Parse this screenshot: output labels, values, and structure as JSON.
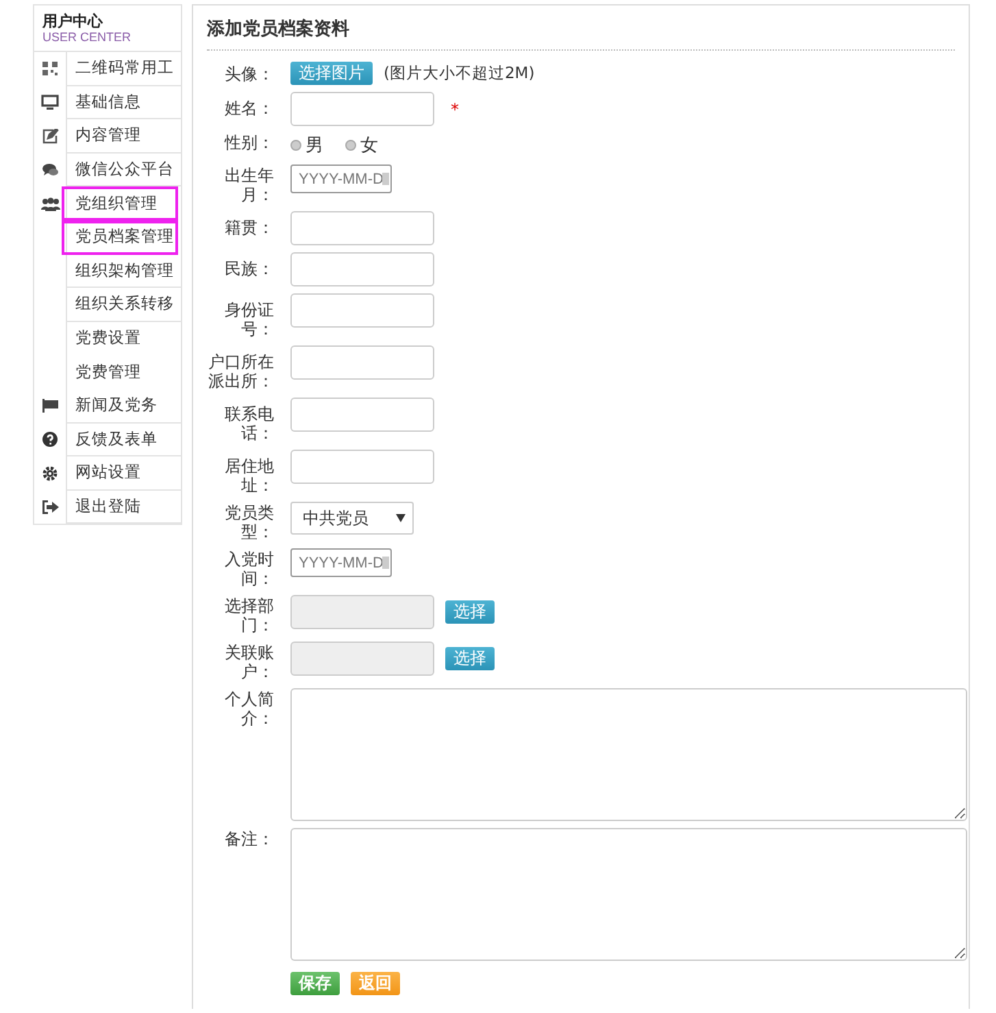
{
  "sidebar": {
    "title": "用户中心",
    "subtitle": "USER CENTER",
    "items": [
      {
        "label": "二维码常用工",
        "highlighted": false
      },
      {
        "label": "基础信息",
        "highlighted": false
      },
      {
        "label": "内容管理",
        "highlighted": false
      },
      {
        "label": "微信公众平台",
        "highlighted": false
      },
      {
        "label": "党组织管理",
        "highlighted": true,
        "children": [
          {
            "label": "党员档案管理",
            "highlighted": true
          },
          {
            "label": "组织架构管理",
            "highlighted": false
          },
          {
            "label": "组织关系转移",
            "highlighted": false
          },
          {
            "label": "党费设置",
            "highlighted": false
          },
          {
            "label": "党费管理",
            "highlighted": false
          }
        ]
      },
      {
        "label": "新闻及党务",
        "highlighted": false
      },
      {
        "label": "反馈及表单",
        "highlighted": false
      },
      {
        "label": "网站设置",
        "highlighted": false
      },
      {
        "label": "退出登陆",
        "highlighted": false
      }
    ]
  },
  "form": {
    "title": "添加党员档案资料",
    "fields": [
      {
        "kind": "file",
        "label": "头像：",
        "button": "选择图片",
        "note": "(图片大小不超过2M)"
      },
      {
        "kind": "text",
        "label": "姓名：",
        "required_mark": "*"
      },
      {
        "kind": "radio",
        "label": "性别：",
        "options": [
          {
            "label": "男",
            "selected": false
          },
          {
            "label": "女",
            "selected": false
          }
        ]
      },
      {
        "kind": "date",
        "label": "出生年月：",
        "placeholder": "YYYY-MM-D"
      },
      {
        "kind": "text",
        "label": "籍贯："
      },
      {
        "kind": "text",
        "label": "民族："
      },
      {
        "kind": "text",
        "label": "身份证号："
      },
      {
        "kind": "text",
        "label": "户口所在派出所："
      },
      {
        "kind": "text",
        "label": "联系电话："
      },
      {
        "kind": "text",
        "label": "居住地址："
      },
      {
        "kind": "select",
        "label": "党员类型：",
        "value": "中共党员"
      },
      {
        "kind": "date",
        "label": "入党时间：",
        "placeholder": "YYYY-MM-D"
      },
      {
        "kind": "picker",
        "label": "选择部门：",
        "button": "选择"
      },
      {
        "kind": "picker",
        "label": "关联账户：",
        "button": "选择"
      },
      {
        "kind": "textarea",
        "label": "个人简介："
      },
      {
        "kind": "textarea",
        "label": "备注："
      }
    ],
    "buttons": [
      "保存",
      "返回"
    ]
  }
}
